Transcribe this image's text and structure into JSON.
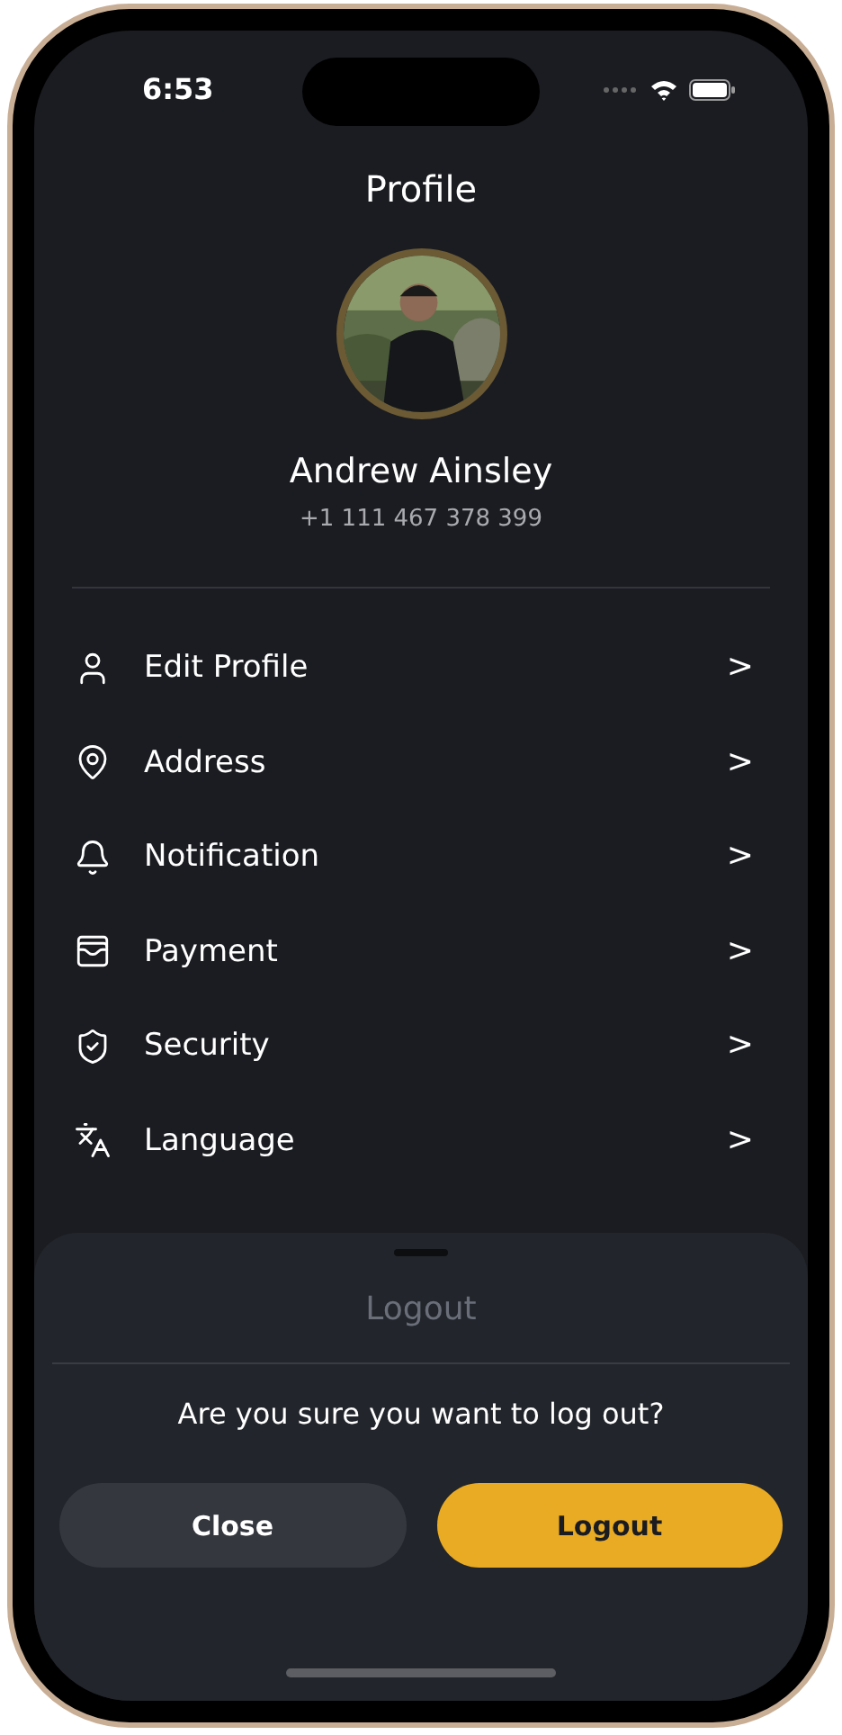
{
  "status_bar": {
    "time": "6:53"
  },
  "header": {
    "title": "Profile"
  },
  "profile": {
    "name": "Andrew Ainsley",
    "phone": "+1 111 467 378 399"
  },
  "menu": [
    {
      "label": "Edit Profile",
      "chevron": ">"
    },
    {
      "label": "Address",
      "chevron": ">"
    },
    {
      "label": "Notification",
      "chevron": ">"
    },
    {
      "label": "Payment",
      "chevron": ">"
    },
    {
      "label": "Security",
      "chevron": ">"
    },
    {
      "label": "Language",
      "chevron": ">"
    }
  ],
  "sheet": {
    "title": "Logout",
    "message": "Are you sure you want to log out?",
    "buttons": [
      {
        "label": "Close",
        "kind": "secondary"
      },
      {
        "label": "Logout",
        "kind": "primary"
      }
    ]
  }
}
